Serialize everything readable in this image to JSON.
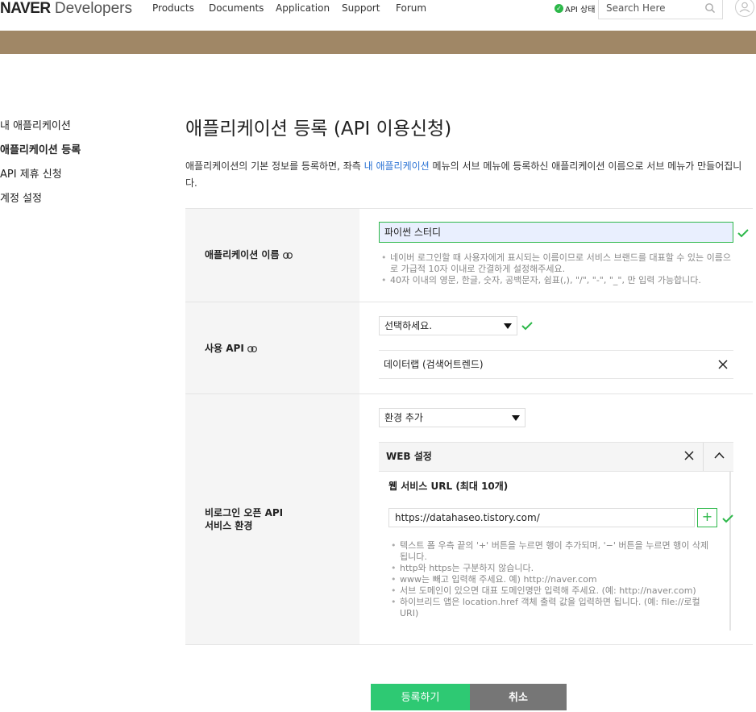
{
  "header": {
    "logo_brand": "NAVER",
    "logo_product": "Developers",
    "nav": [
      "Products",
      "Documents",
      "Application",
      "Support",
      "Forum"
    ],
    "api_status": "API 상태",
    "search_placeholder": "Search Here"
  },
  "colors": {
    "banner": "#a08766",
    "accent_green": "#2db84a",
    "link_blue": "#2b73d4",
    "register_btn": "#2ec973",
    "cancel_btn": "#767676"
  },
  "sidebar": {
    "items": [
      {
        "label": "내 애플리케이션",
        "active": false
      },
      {
        "label": "애플리케이션 등록",
        "active": true
      },
      {
        "label": "API 제휴 신청",
        "active": false
      },
      {
        "label": "계정 설정",
        "active": false
      }
    ]
  },
  "page": {
    "title": "애플리케이션 등록 (API 이용신청)",
    "desc_before": "애플리케이션의 기본 정보를 등록하면, 좌측 ",
    "desc_link": "내 애플리케이션",
    "desc_after": " 메뉴의 서브 메뉴에 등록하신 애플리케이션 이름으로 서브 메뉴가 만들어집니다."
  },
  "form": {
    "app_name": {
      "label": "애플리케이션 이름",
      "value": "파이썬 스터디",
      "hints": [
        "네이버 로그인할 때 사용자에게 표시되는 이름이므로 서비스 브랜드를 대표할 수 있는 이름으로 가급적 10자 이내로 간결하게 설정해주세요.",
        "40자 이내의 영문, 한글, 숫자, 공백문자, 쉼표(,), \"/\", \"-\", \"_\", 만 입력 가능합니다."
      ]
    },
    "api": {
      "label": "사용 API",
      "select_value": "선택하세요.",
      "selected_api": "데이터랩 (검색어트렌드)"
    },
    "env": {
      "label_line1": "비로그인 오픈 API",
      "label_line2": "서비스 환경",
      "select_value": "환경 추가",
      "web_title": "WEB 설정",
      "url_label": "웹 서비스 URL (최대 10개)",
      "url_value": "https://datahaseo.tistory.com/",
      "plus": "+",
      "hints": [
        "텍스트 폼 우측 끝의 '+' 버튼을 누르면 행이 추가되며, '−' 버튼을 누르면 행이 삭제됩니다.",
        "http와 https는 구분하지 않습니다.",
        "www는 빼고 입력해 주세요. 예) http://naver.com",
        "서브 도메인이 있으면 대표 도메인명만 입력해 주세요. (예: http://naver.com)",
        "하이브리드 앱은 location.href 객체 출력 값을 입력하면 됩니다. (예: file://로컬URI)"
      ]
    }
  },
  "buttons": {
    "register": "등록하기",
    "cancel": "취소"
  }
}
